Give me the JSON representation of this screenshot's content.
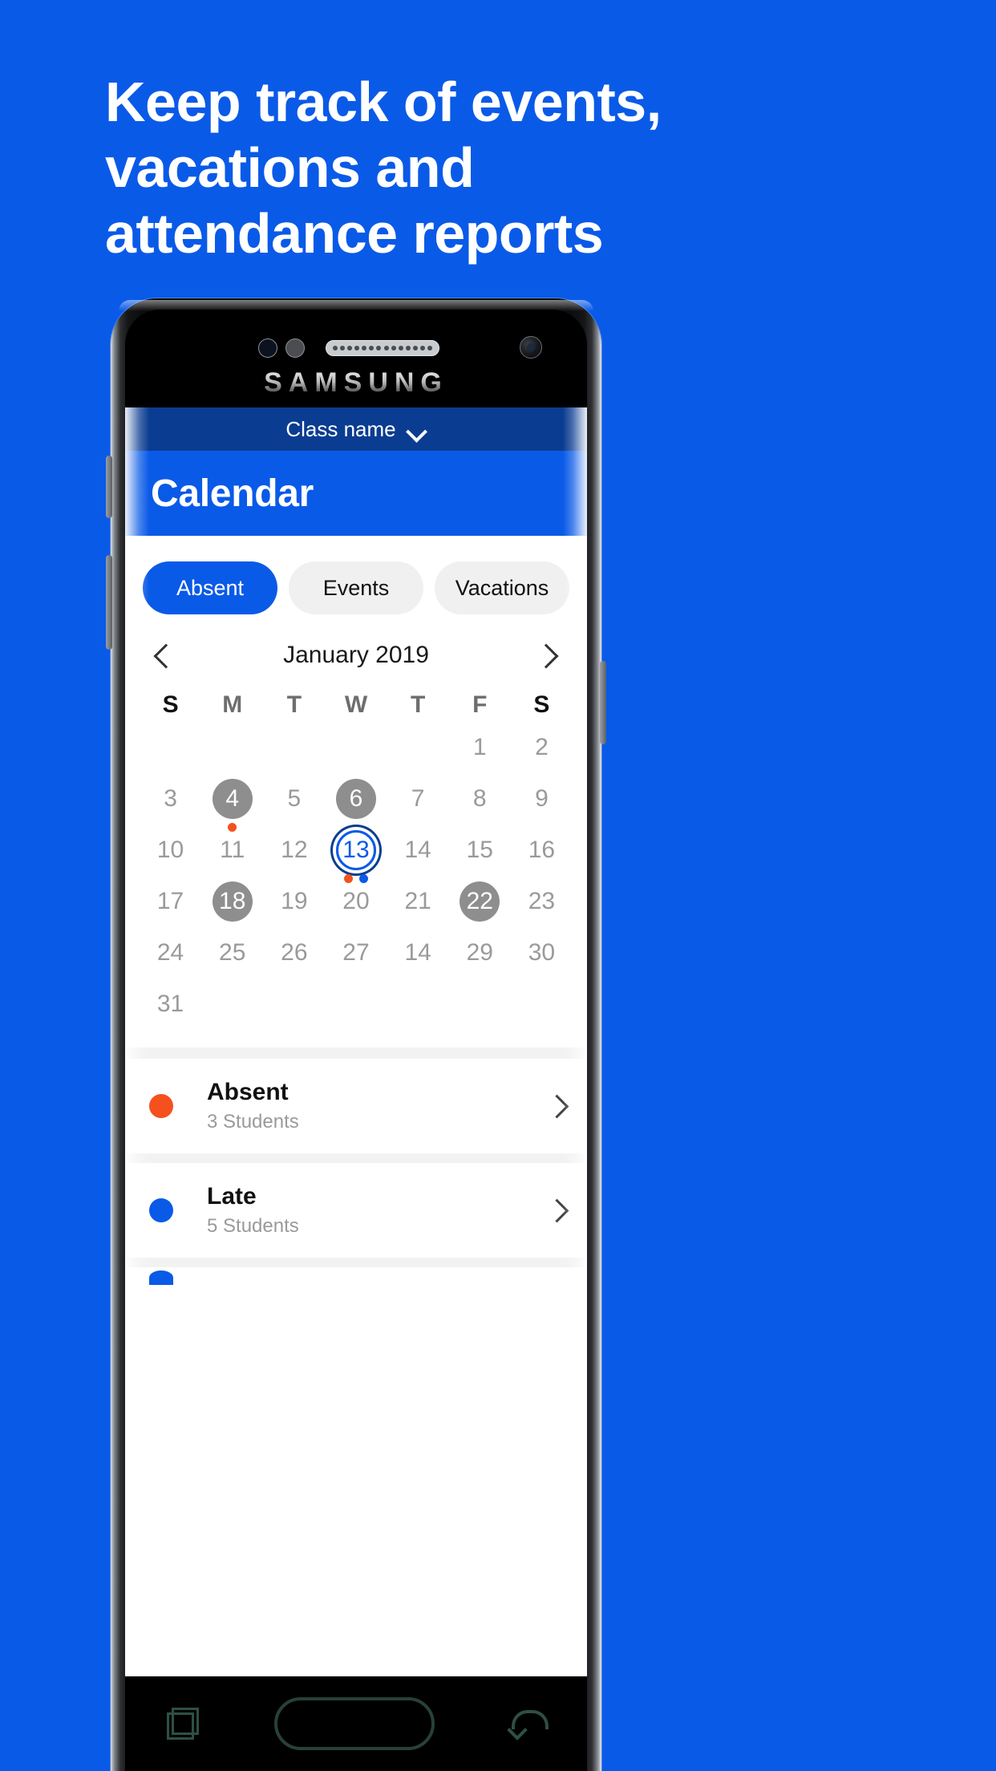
{
  "theme": {
    "brand_blue": "#0a5ae8",
    "dark_blue": "#0a3d91",
    "absent_orange": "#f4511e",
    "late_blue": "#0a5ae8",
    "marked_gray": "#8e8e8e"
  },
  "headline": {
    "line1": "Keep track of events,",
    "line2": "vacations and",
    "line3": "attendance reports"
  },
  "device": {
    "brand": "SAMSUNG"
  },
  "app": {
    "class_selector": {
      "label": "Class name",
      "icon": "chevron-down-icon"
    },
    "appbar": {
      "title": "Calendar"
    },
    "tabs": [
      {
        "label": "Absent",
        "active": true
      },
      {
        "label": "Events",
        "active": false
      },
      {
        "label": "Vacations",
        "active": false
      }
    ],
    "calendar": {
      "month_label": "January 2019",
      "prev_icon": "chevron-left-icon",
      "next_icon": "chevron-right-icon",
      "weekdays": [
        {
          "label": "S",
          "weekend": true
        },
        {
          "label": "M",
          "weekend": false
        },
        {
          "label": "T",
          "weekend": false
        },
        {
          "label": "W",
          "weekend": false
        },
        {
          "label": "T",
          "weekend": false
        },
        {
          "label": "F",
          "weekend": false
        },
        {
          "label": "S",
          "weekend": true
        }
      ],
      "weeks": [
        [
          {
            "day": ""
          },
          {
            "day": ""
          },
          {
            "day": ""
          },
          {
            "day": ""
          },
          {
            "day": ""
          },
          {
            "day": "1"
          },
          {
            "day": "2"
          }
        ],
        [
          {
            "day": "3"
          },
          {
            "day": "4",
            "marked": true,
            "dots": [
              "absent"
            ]
          },
          {
            "day": "5"
          },
          {
            "day": "6",
            "marked": true
          },
          {
            "day": "7"
          },
          {
            "day": "8"
          },
          {
            "day": "9"
          }
        ],
        [
          {
            "day": "10"
          },
          {
            "day": "11"
          },
          {
            "day": "12"
          },
          {
            "day": "13",
            "today": true,
            "dots": [
              "absent",
              "late"
            ]
          },
          {
            "day": "14"
          },
          {
            "day": "15"
          },
          {
            "day": "16"
          }
        ],
        [
          {
            "day": "17"
          },
          {
            "day": "18",
            "marked": true
          },
          {
            "day": "19"
          },
          {
            "day": "20"
          },
          {
            "day": "21"
          },
          {
            "day": "22",
            "marked": true
          },
          {
            "day": "23"
          }
        ],
        [
          {
            "day": "24"
          },
          {
            "day": "25"
          },
          {
            "day": "26"
          },
          {
            "day": "27"
          },
          {
            "day": "14"
          },
          {
            "day": "29"
          },
          {
            "day": "30"
          }
        ],
        [
          {
            "day": "31"
          },
          {
            "day": ""
          },
          {
            "day": ""
          },
          {
            "day": ""
          },
          {
            "day": ""
          },
          {
            "day": ""
          },
          {
            "day": ""
          }
        ]
      ]
    },
    "summary": [
      {
        "title": "Absent",
        "subtitle": "3 Students",
        "color": "absent",
        "chevron": "chevron-right-icon"
      },
      {
        "title": "Late",
        "subtitle": "5 Students",
        "color": "late",
        "chevron": "chevron-right-icon"
      }
    ]
  },
  "navbar": {
    "recent_icon": "recent-apps-icon",
    "home_icon": "home-button",
    "back_icon": "back-icon"
  }
}
